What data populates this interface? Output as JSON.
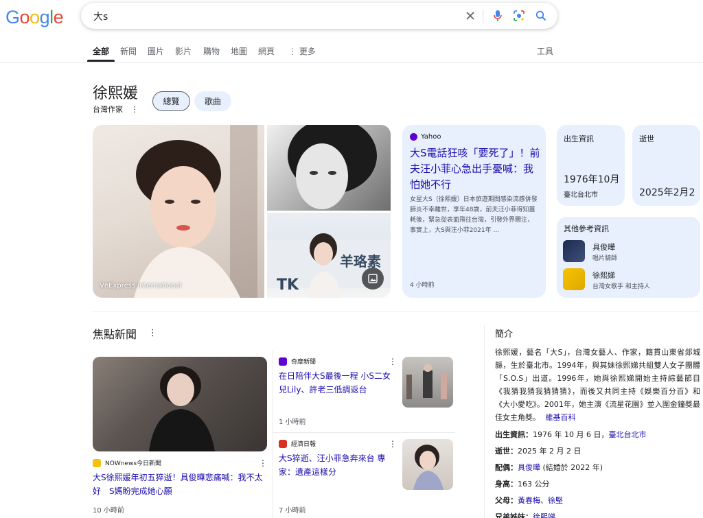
{
  "search": {
    "query": "大s"
  },
  "tabs": [
    "全部",
    "新聞",
    "圖片",
    "影片",
    "購物",
    "地圖",
    "網頁",
    "更多",
    "工具"
  ],
  "entity": {
    "name": "徐熙媛",
    "subtitle": "台灣作家",
    "chips": [
      "總覽",
      "歌曲"
    ]
  },
  "images": {
    "main_caption": "VnExpress International"
  },
  "news_card": {
    "source": "Yahoo",
    "title": "大S電話狂咳「要死了」！前夫汪小菲心急出手憂喊：我怕她不行",
    "snippet": "女星大S（徐熙媛）日本旅遊期間感染流感併發肺炎不幸離世，享年48歲，前夫汪小菲得知噩耗後，緊急從表面飛往台灣，引發外界關注，事實上，大S與汪小菲2021年 ...",
    "time": "4 小時前"
  },
  "facts": {
    "birth_label": "出生資訊",
    "birth_date": "1976年10月",
    "birth_place": "臺北台北市",
    "death_label": "逝世",
    "death_date": "2025年2月2"
  },
  "others": {
    "label": "其他參考資訊",
    "people": [
      {
        "name": "具俊曄",
        "desc": "唱片騎師"
      },
      {
        "name": "徐熙娣",
        "desc": "台灣女歌手 和主持人"
      }
    ]
  },
  "top_stories": {
    "title": "焦點新聞",
    "stories": [
      {
        "source": "NOWnews今日新聞",
        "title": "大S徐熙媛年初五猝逝！具俊曄悲痛喊：我不太好　S媽盼完成她心願",
        "time": "10 小時前",
        "color": "#f4c20d"
      },
      {
        "source": "奇摩新聞",
        "title": "在日陪伴大S最後一程 小S二女兒Lily、許老三低調返台",
        "time": "1 小時前",
        "color": "#6001d2"
      },
      {
        "source": "經濟日報",
        "title": "大S猝逝、汪小菲急奔來台 專家：遺產這樣分",
        "time": "7 小時前",
        "color": "#d93025"
      }
    ]
  },
  "about": {
    "title": "簡介",
    "text": "徐熙媛，藝名「大S」，台灣女藝人、作家，籍貫山東省郯城縣，生於臺北市。1994年，與其妹徐熙娣共組雙人女子團體「S.O.S」出道。1996年，她與徐熙娣開始主持綜藝節目《我猜我猜我猜猜猜》，而後又共同主持《娛樂百分百》和《大小愛吃》。2001年，她主演《流星花園》並入圍金鐘獎最佳女主角獎。",
    "wiki": "維基百科",
    "rows": [
      {
        "label": "出生資訊：",
        "value": "1976 年 10 月 6 日，",
        "link": "臺北台北市"
      },
      {
        "label": "逝世：",
        "value": "2025 年 2 月 2 日",
        "link": ""
      },
      {
        "label": "配偶：",
        "value": "",
        "link": "具俊曄",
        "after": " (結婚於 2022 年)"
      },
      {
        "label": "身高：",
        "value": "163 公分",
        "link": ""
      },
      {
        "label": "父母：",
        "value": "",
        "link": "黃春梅",
        "link2": "徐堅"
      },
      {
        "label": "兄弟姊妹：",
        "value": "",
        "link": "徐熙娣"
      }
    ]
  }
}
